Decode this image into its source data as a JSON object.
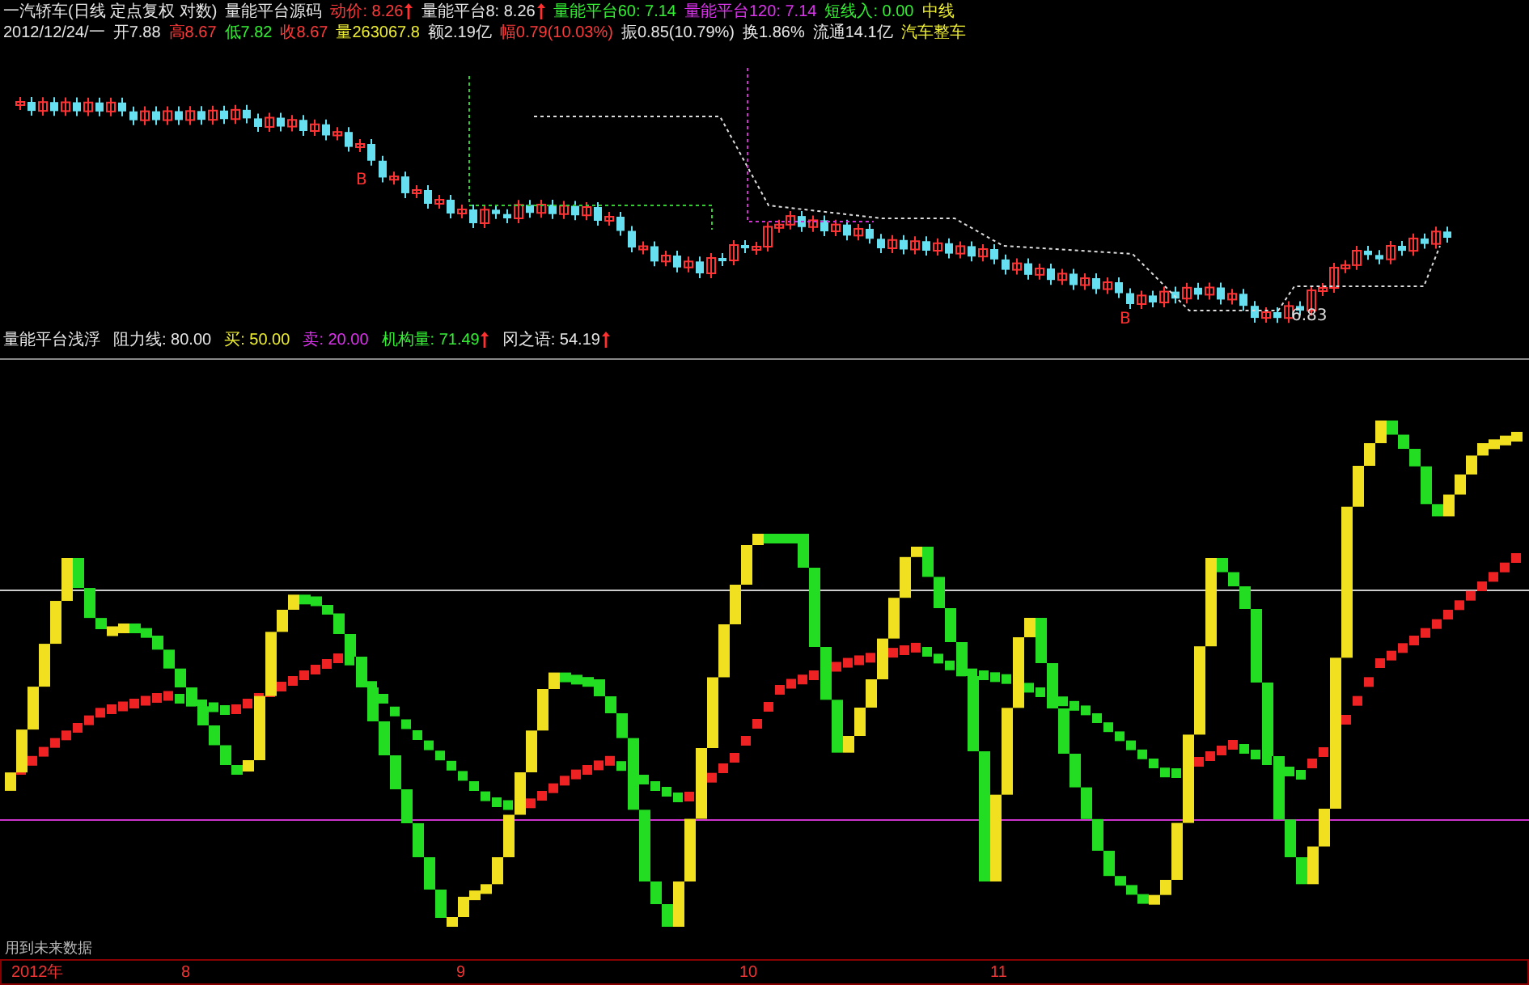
{
  "header": {
    "title_line": [
      {
        "text": "一汽轿车(日线 定点复权 对数)",
        "color": "#e6e6e6",
        "arrow": false
      },
      {
        "text": "量能平台源码",
        "color": "#e6e6e6",
        "arrow": false
      },
      {
        "text": "动价: 8.26",
        "color": "#ff3a3a",
        "arrow": true
      },
      {
        "text": "量能平台8: 8.26",
        "color": "#e6e6e6",
        "arrow": true
      },
      {
        "text": "量能平台60: 7.14",
        "color": "#33ee33",
        "arrow": false
      },
      {
        "text": "量能平台120: 7.14",
        "color": "#dd33ee",
        "arrow": false
      },
      {
        "text": "短线入: 0.00",
        "color": "#33ee33",
        "arrow": false
      },
      {
        "text": "中线",
        "color": "#eeee33",
        "arrow": false
      }
    ],
    "quote_line": [
      {
        "text": "2012/12/24/一",
        "color": "#e6e6e6",
        "arrow": false
      },
      {
        "text": "开7.88",
        "color": "#e6e6e6",
        "arrow": false
      },
      {
        "text": "高8.67",
        "color": "#ff3a3a",
        "arrow": false
      },
      {
        "text": "低7.82",
        "color": "#33ee33",
        "arrow": false
      },
      {
        "text": "收8.67",
        "color": "#ff3a3a",
        "arrow": false
      },
      {
        "text": "量263067.8",
        "color": "#eeee33",
        "arrow": false
      },
      {
        "text": "额2.19亿",
        "color": "#e6e6e6",
        "arrow": false
      },
      {
        "text": "幅0.79(10.03%)",
        "color": "#ff3a3a",
        "arrow": false
      },
      {
        "text": "振0.85(10.79%)",
        "color": "#e6e6e6",
        "arrow": false
      },
      {
        "text": "换1.86%",
        "color": "#e6e6e6",
        "arrow": false
      },
      {
        "text": "流通14.1亿",
        "color": "#e6e6e6",
        "arrow": false
      },
      {
        "text": "汽车整车",
        "color": "#eeee33",
        "arrow": false
      }
    ]
  },
  "price_chart": {
    "marks": [
      {
        "label": "B"
      },
      {
        "label": "B"
      }
    ],
    "low_label": "6.83"
  },
  "indicator": {
    "items": [
      {
        "text": "量能平台浅浮",
        "color": "#e6e6e6",
        "arrow": false
      },
      {
        "text": "阻力线: 80.00",
        "color": "#e6e6e6",
        "arrow": false
      },
      {
        "text": "买: 50.00",
        "color": "#eeee33",
        "arrow": false
      },
      {
        "text": "卖: 20.00",
        "color": "#dd33ee",
        "arrow": false
      },
      {
        "text": "机构量: 71.49",
        "color": "#33ee33",
        "arrow": true
      },
      {
        "text": "冈之语: 54.19",
        "color": "#e6e6e6",
        "arrow": true
      }
    ]
  },
  "note": "用到未来数据",
  "time_axis": [
    "2012年",
    "8",
    "9",
    "10",
    "11"
  ]
}
